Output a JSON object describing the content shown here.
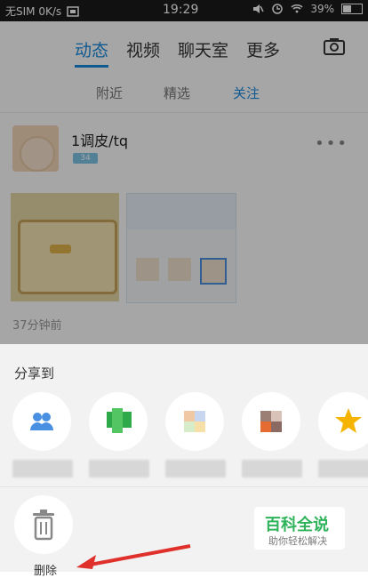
{
  "statusbar": {
    "carrier": "无SIM 0K/s",
    "time": "19:29",
    "battery": "39%"
  },
  "header": {
    "tabs": [
      "动态",
      "视频",
      "聊天室",
      "更多"
    ]
  },
  "subtabs": [
    "附近",
    "精选",
    "关注"
  ],
  "post": {
    "username": "1调皮/tq",
    "badge": "34",
    "time_ago": "37分钟前"
  },
  "sheet": {
    "title": "分享到",
    "delete_label": "删除"
  },
  "watermark": {
    "title": "百科全说",
    "subtitle": "助你轻松解决"
  },
  "colors": {
    "accent": "#1a8be0",
    "overlay": "rgba(0,0,0,0.35)"
  }
}
